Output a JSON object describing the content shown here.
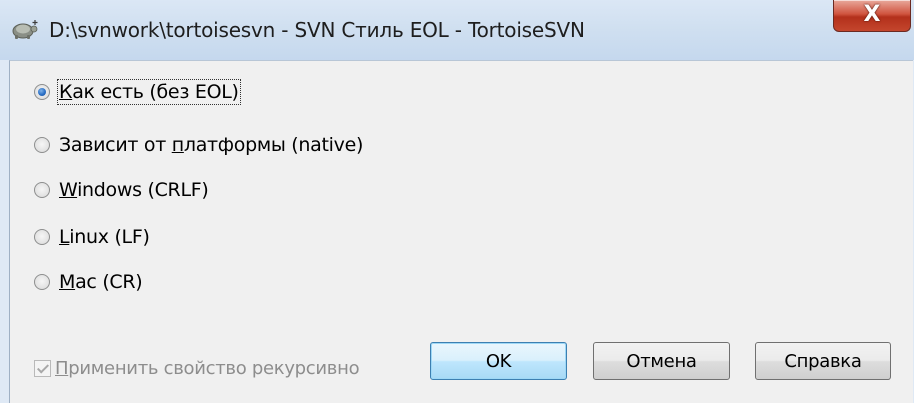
{
  "window": {
    "title": "D:\\svnwork\\tortoisesvn - SVN Стиль EOL - TortoiseSVN",
    "close_glyph": "X",
    "app_icon": "tortoise-icon"
  },
  "eol_options": [
    {
      "pre": "",
      "ul": "К",
      "post": "ак есть (без EOL)",
      "checked": true
    },
    {
      "pre": "Зависит от ",
      "ul": "п",
      "post": "латформы (native)",
      "checked": false
    },
    {
      "pre": "",
      "ul": "W",
      "post": "indows (CRLF)",
      "checked": false
    },
    {
      "pre": "",
      "ul": "L",
      "post": "inux (LF)",
      "checked": false
    },
    {
      "pre": "",
      "ul": "M",
      "post": "ac (CR)",
      "checked": false
    }
  ],
  "recursive": {
    "ul": "П",
    "post": "рименить свойство рекурсивно",
    "checked": true,
    "enabled": false
  },
  "buttons": {
    "ok": "OK",
    "cancel": "Отмена",
    "help": "Справка"
  },
  "colors": {
    "accent_radio": "#2a6fc6",
    "close_button": "#c4462d",
    "default_button_border": "#3c7fb1"
  }
}
